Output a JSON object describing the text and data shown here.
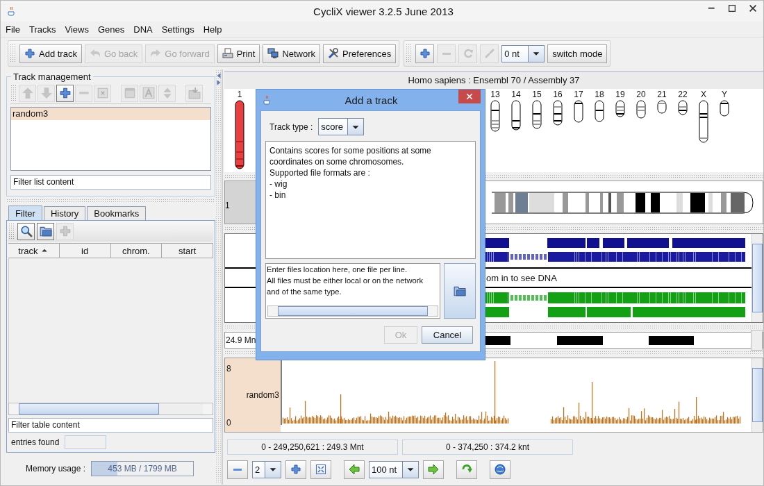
{
  "window": {
    "title": "CycliX viewer 3.2.5 June 2013"
  },
  "menu": [
    "File",
    "Tracks",
    "Views",
    "Genes",
    "DNA",
    "Settings",
    "Help"
  ],
  "toolbar": [
    {
      "label": "Add track",
      "disabled": false
    },
    {
      "label": "Go back",
      "disabled": true
    },
    {
      "label": "Go forward",
      "disabled": true
    },
    {
      "label": "Print",
      "disabled": false
    },
    {
      "label": "Network",
      "disabled": false
    },
    {
      "label": "Preferences",
      "disabled": false
    }
  ],
  "zoom_toolbar": {
    "buttons": [
      {
        "disabled": false
      },
      {
        "disabled": true
      },
      {
        "disabled": true
      },
      {
        "disabled": true
      }
    ],
    "step": "0 nt",
    "switch_label": "switch mode"
  },
  "track_management": {
    "title": "Track management",
    "tools": [
      {
        "disabled": true
      },
      {
        "disabled": true
      },
      {
        "disabled": false
      },
      {
        "disabled": true
      },
      {
        "disabled": true
      },
      {
        "disabled": true
      },
      {
        "disabled": true
      },
      {
        "disabled": true
      },
      {
        "disabled": true
      }
    ],
    "tracks": [
      {
        "name": "random3",
        "selected": true
      }
    ],
    "filter": "Filter list content"
  },
  "left_tabs": [
    {
      "label": "Filter",
      "selected": true
    },
    {
      "label": "History",
      "selected": false
    },
    {
      "label": "Bookmarks",
      "selected": false
    }
  ],
  "filter_panel": {
    "tools": [
      {
        "disabled": false
      },
      {
        "disabled": false
      },
      {
        "disabled": true
      }
    ],
    "columns": [
      {
        "label": "track",
        "sorted": true
      },
      {
        "label": "id",
        "sorted": false
      },
      {
        "label": "chrom.",
        "sorted": false
      },
      {
        "label": "start",
        "sorted": false
      }
    ],
    "filter": "Filter table content",
    "entries_label": "entries found"
  },
  "memory": {
    "label": "Memory usage :",
    "reading": "453 MB / 1799 MB",
    "level": 0.25
  },
  "genome": {
    "header": "Homo sapiens : Ensembl 70 / Assembly 37",
    "chromosomes": [
      {
        "label": "1",
        "selected": true
      },
      {
        "label": "13",
        "selected": false
      },
      {
        "label": "14",
        "selected": false
      },
      {
        "label": "15",
        "selected": false
      },
      {
        "label": "16",
        "selected": false
      },
      {
        "label": "17",
        "selected": false
      },
      {
        "label": "18",
        "selected": false
      },
      {
        "label": "19",
        "selected": false
      },
      {
        "label": "20",
        "selected": false
      },
      {
        "label": "21",
        "selected": false
      },
      {
        "label": "22",
        "selected": false
      },
      {
        "label": "X",
        "selected": false
      },
      {
        "label": "Y",
        "selected": false
      }
    ]
  },
  "karyotype": {
    "label": "1"
  },
  "genes": {
    "message": "om in to see DNA"
  },
  "ruler": {
    "label": "24.9 Mn"
  },
  "score_track": {
    "name": "random3",
    "max": "8",
    "min": "0"
  },
  "positions": [
    "0 - 249,250,621 : 249.3 Mnt",
    "0 - 374,250 : 374.2 knt"
  ],
  "navigation": {
    "zoom": "2",
    "step": "100 nt"
  },
  "dialog": {
    "title": "Add a track",
    "type_label": "Track type :",
    "type": "score",
    "description": "Contains scores for some positions at some\ncoordinates on some chromosomes.\nSupported file formats are :\n- wig\n- bin",
    "files_text": "Enter files location here, one file per line.\nAll files must be either local or on the network\nand of the same type.",
    "buttons": [
      {
        "label": "Ok",
        "disabled": true
      },
      {
        "label": "Cancel",
        "disabled": false
      }
    ]
  }
}
